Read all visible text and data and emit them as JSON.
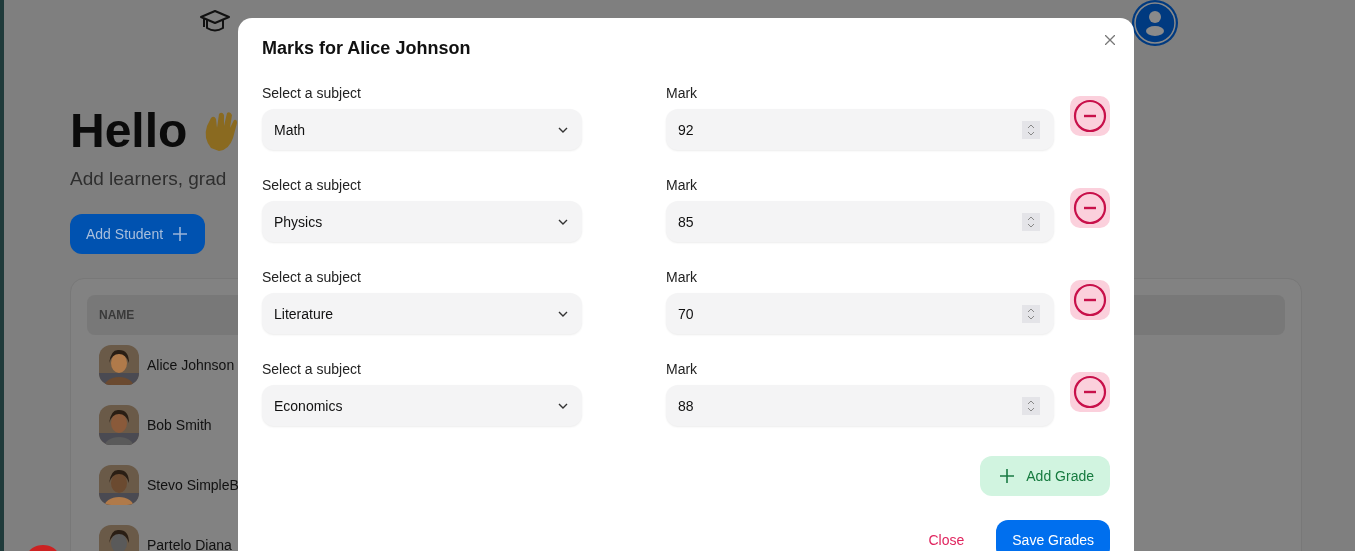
{
  "page": {
    "heading": "Hello",
    "subtitle": "Add learners, grad",
    "add_button": "Add Student",
    "table": {
      "columns": [
        "NAME"
      ],
      "rows": [
        {
          "name": "Alice Johnson"
        },
        {
          "name": "Bob Smith"
        },
        {
          "name": "Stevo SimpleB"
        },
        {
          "name": "Partelo Diana"
        }
      ]
    }
  },
  "modal": {
    "title": "Marks for Alice Johnson",
    "grades": [
      {
        "subject_label": "Select a subject",
        "subject": "Math",
        "mark_label": "Mark",
        "mark": "92"
      },
      {
        "subject_label": "Select a subject",
        "subject": "Physics",
        "mark_label": "Mark",
        "mark": "85"
      },
      {
        "subject_label": "Select a subject",
        "subject": "Literature",
        "mark_label": "Mark",
        "mark": "70"
      },
      {
        "subject_label": "Select a subject",
        "subject": "Economics",
        "mark_label": "Mark",
        "mark": "88"
      }
    ],
    "add_button": "Add Grade",
    "close_button": "Close",
    "save_button": "Save Grades"
  }
}
